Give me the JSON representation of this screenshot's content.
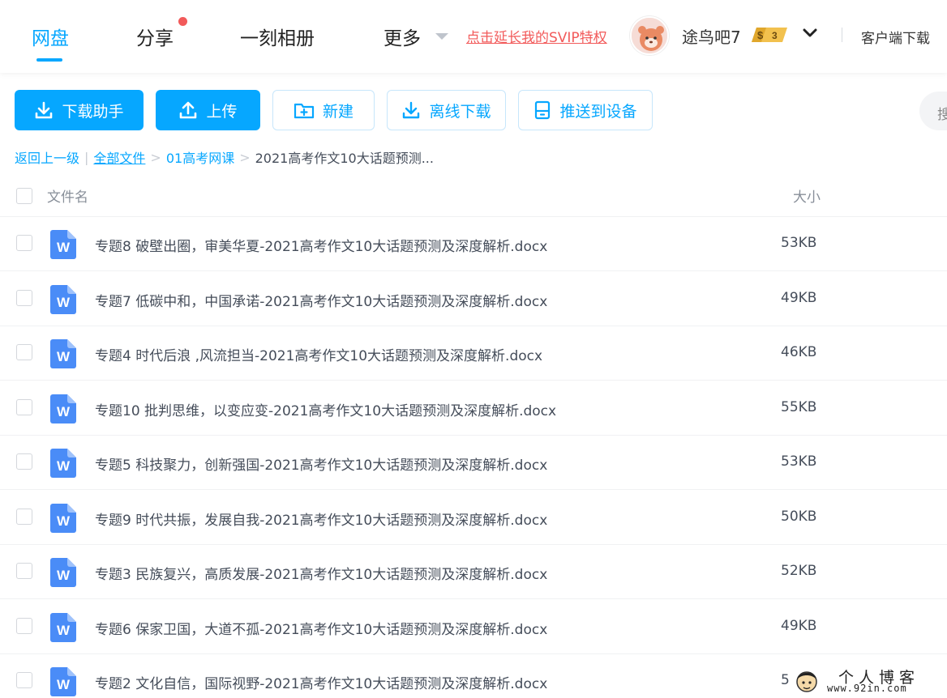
{
  "nav": {
    "tabs": [
      {
        "label": "网盘",
        "active": true
      },
      {
        "label": "分享",
        "has_dot": true
      },
      {
        "label": "一刻相册"
      },
      {
        "label": "更多"
      }
    ],
    "promo": "点击延长我的SVIP特权",
    "username": "途鸟吧7",
    "vip_level": "3",
    "client_download": "客户端下载"
  },
  "toolbar": {
    "download_helper": "下载助手",
    "upload": "上传",
    "new": "新建",
    "offline_download": "离线下载",
    "push_to_device": "推送到设备",
    "search_placeholder": "搜"
  },
  "breadcrumb": {
    "back": "返回上一级",
    "sep_bar": "|",
    "all_files": "全部文件",
    "sep": ">",
    "folder": "01高考网课",
    "current": "2021高考作文10大话题预测..."
  },
  "table": {
    "col_name": "文件名",
    "col_size": "大小",
    "rows": [
      {
        "name": "专题8 破壁出圈，审美华夏-2021高考作文10大话题预测及深度解析.docx",
        "size": "53KB"
      },
      {
        "name": "专题7 低碳中和，中国承诺-2021高考作文10大话题预测及深度解析.docx",
        "size": "49KB"
      },
      {
        "name": "专题4 时代后浪 ,风流担当-2021高考作文10大话题预测及深度解析.docx",
        "size": "46KB"
      },
      {
        "name": "专题10 批判思维，以变应变-2021高考作文10大话题预测及深度解析.docx",
        "size": "55KB"
      },
      {
        "name": "专题5 科技聚力，创新强国-2021高考作文10大话题预测及深度解析.docx",
        "size": "53KB"
      },
      {
        "name": "专题9 时代共振，发展自我-2021高考作文10大话题预测及深度解析.docx",
        "size": "50KB"
      },
      {
        "name": "专题3 民族复兴，高质发展-2021高考作文10大话题预测及深度解析.docx",
        "size": "52KB"
      },
      {
        "name": "专题6 保家卫国，大道不孤-2021高考作文10大话题预测及深度解析.docx",
        "size": "49KB"
      },
      {
        "name": "专题2 文化自信，国际视野-2021高考作文10大话题预测及深度解析.docx",
        "size": "5"
      }
    ]
  },
  "watermark": {
    "title": "个人博客",
    "url": "www.92in.com"
  },
  "icons": {
    "file": "word-doc-icon",
    "download": "download-icon",
    "upload": "upload-icon",
    "new": "new-folder-icon",
    "offline": "offline-download-icon",
    "device": "device-icon"
  },
  "colors": {
    "accent": "#06a7ff",
    "promo": "#f25a5a",
    "word_icon": "#4a8cf7"
  }
}
